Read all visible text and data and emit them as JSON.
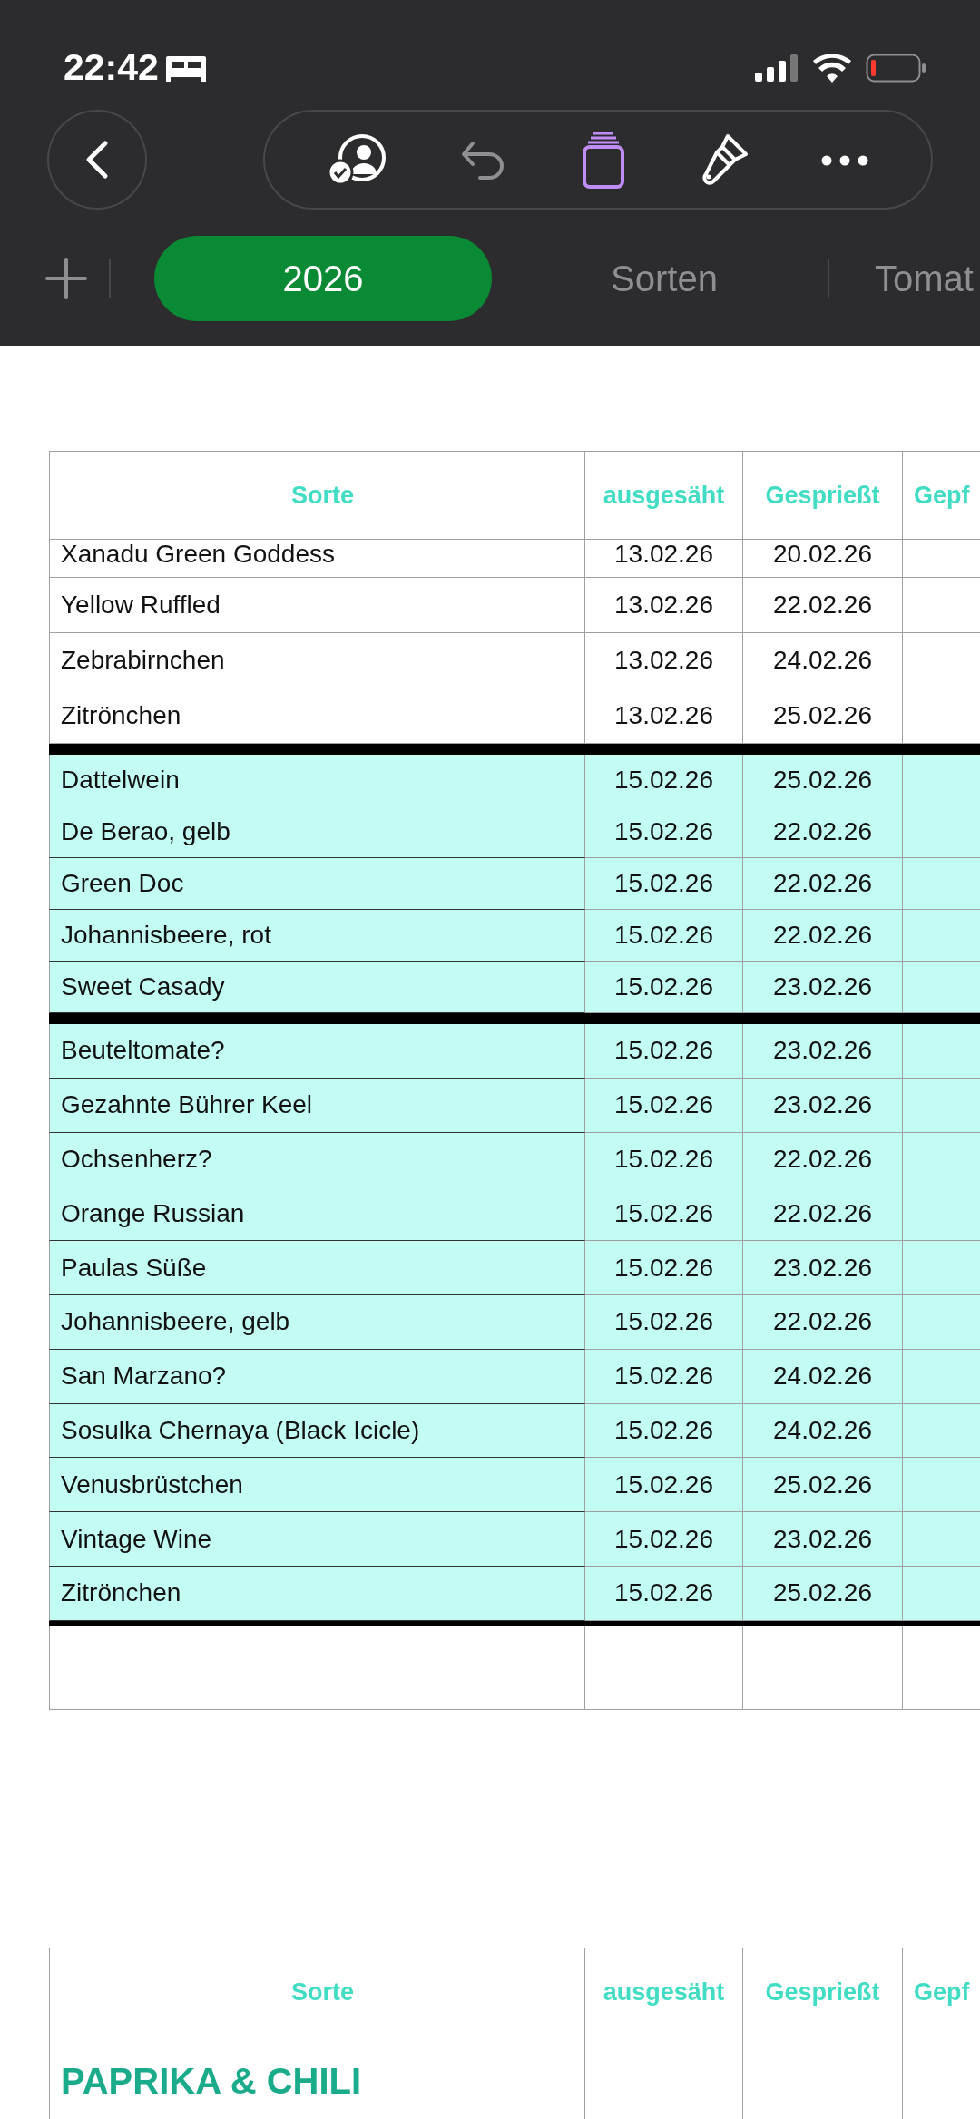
{
  "status_bar": {
    "time": "22:42"
  },
  "sheet_tabs": [
    {
      "label": "2026",
      "selected": true
    },
    {
      "label": "Sorten",
      "selected": false
    },
    {
      "label": "Tomat",
      "selected": false
    }
  ],
  "tables": [
    {
      "columns": [
        "Sorte",
        "ausgesäht",
        "Gesprießt",
        "Gepf"
      ],
      "groups": [
        {
          "highlighted": false,
          "rows": [
            {
              "sorte": "Xanadu Green Goddess",
              "ausgesaeht": "13.02.26",
              "gespriesst": "20.02.26"
            },
            {
              "sorte": "Yellow Ruffled",
              "ausgesaeht": "13.02.26",
              "gespriesst": "22.02.26"
            },
            {
              "sorte": "Zebrabirnchen",
              "ausgesaeht": "13.02.26",
              "gespriesst": "24.02.26"
            },
            {
              "sorte": "Zitrönchen",
              "ausgesaeht": "13.02.26",
              "gespriesst": "25.02.26"
            }
          ]
        },
        {
          "highlighted": true,
          "rows": [
            {
              "sorte": "Dattelwein",
              "ausgesaeht": "15.02.26",
              "gespriesst": "25.02.26"
            },
            {
              "sorte": "De Berao, gelb",
              "ausgesaeht": "15.02.26",
              "gespriesst": "22.02.26"
            },
            {
              "sorte": "Green Doc",
              "ausgesaeht": "15.02.26",
              "gespriesst": "22.02.26"
            },
            {
              "sorte": "Johannisbeere, rot",
              "ausgesaeht": "15.02.26",
              "gespriesst": "22.02.26"
            },
            {
              "sorte": "Sweet Casady",
              "ausgesaeht": "15.02.26",
              "gespriesst": "23.02.26"
            }
          ]
        },
        {
          "highlighted": true,
          "rows": [
            {
              "sorte": "Beuteltomate?",
              "ausgesaeht": "15.02.26",
              "gespriesst": "23.02.26"
            },
            {
              "sorte": "Gezahnte Bührer Keel",
              "ausgesaeht": "15.02.26",
              "gespriesst": "23.02.26"
            },
            {
              "sorte": "Ochsenherz?",
              "ausgesaeht": "15.02.26",
              "gespriesst": "22.02.26"
            },
            {
              "sorte": "Orange Russian",
              "ausgesaeht": "15.02.26",
              "gespriesst": "22.02.26"
            },
            {
              "sorte": "Paulas Süße",
              "ausgesaeht": "15.02.26",
              "gespriesst": "23.02.26"
            },
            {
              "sorte": "Johannisbeere, gelb",
              "ausgesaeht": "15.02.26",
              "gespriesst": "22.02.26"
            },
            {
              "sorte": "San Marzano?",
              "ausgesaeht": "15.02.26",
              "gespriesst": "24.02.26"
            },
            {
              "sorte": "Sosulka Chernaya (Black Icicle)",
              "ausgesaeht": "15.02.26",
              "gespriesst": "24.02.26"
            },
            {
              "sorte": "Venusbrüstchen",
              "ausgesaeht": "15.02.26",
              "gespriesst": "25.02.26"
            },
            {
              "sorte": "Vintage Wine",
              "ausgesaeht": "15.02.26",
              "gespriesst": "23.02.26"
            },
            {
              "sorte": "Zitrönchen",
              "ausgesaeht": "15.02.26",
              "gespriesst": "25.02.26"
            }
          ]
        }
      ]
    },
    {
      "columns": [
        "Sorte",
        "ausgesäht",
        "Gesprießt",
        "Gepf"
      ],
      "section_title": "PAPRIKA & CHILI"
    }
  ]
}
